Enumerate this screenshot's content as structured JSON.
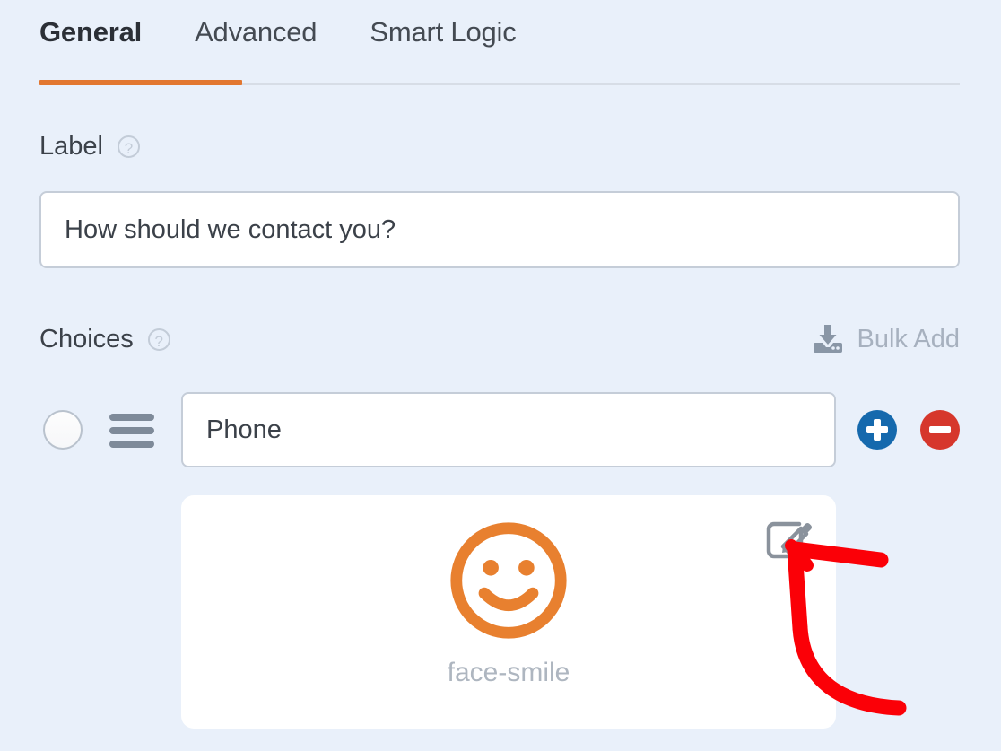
{
  "panel": {
    "tabs": [
      {
        "label": "General",
        "active": true
      },
      {
        "label": "Advanced",
        "active": false
      },
      {
        "label": "Smart Logic",
        "active": false
      }
    ]
  },
  "label_field": {
    "title": "Label",
    "help_icon": "question-circle-icon",
    "value": "How should we contact you?",
    "placeholder": "How should we contact you?"
  },
  "choices_section": {
    "title": "Choices",
    "help_icon": "question-circle-icon",
    "bulk_add": {
      "label": "Bulk Add",
      "icon": "import-download-icon"
    },
    "rows": [
      {
        "radio_icon": "radio-unchecked-icon",
        "drag_icon": "drag-handle-icon",
        "value": "Phone",
        "placeholder": "Phone",
        "add_icon": "plus-circle-icon",
        "remove_icon": "minus-circle-icon"
      }
    ]
  },
  "icon_card": {
    "icon": "face-smile-icon",
    "name": "face-smile",
    "edit_icon": "pencil-square-icon"
  },
  "annotation": {
    "shape": "curved-arrow-up-left",
    "color": "#fb0007"
  },
  "colors": {
    "background": "#e9f0fa",
    "accent_orange": "#e27730",
    "tab_text": "#3b4149",
    "muted_text": "#a7b1bf",
    "input_border": "#c5cdd8",
    "add_blue": "#1569ad",
    "remove_red": "#d6372c",
    "icon_orange": "#e8802f",
    "annotation_red": "#fb0007"
  }
}
